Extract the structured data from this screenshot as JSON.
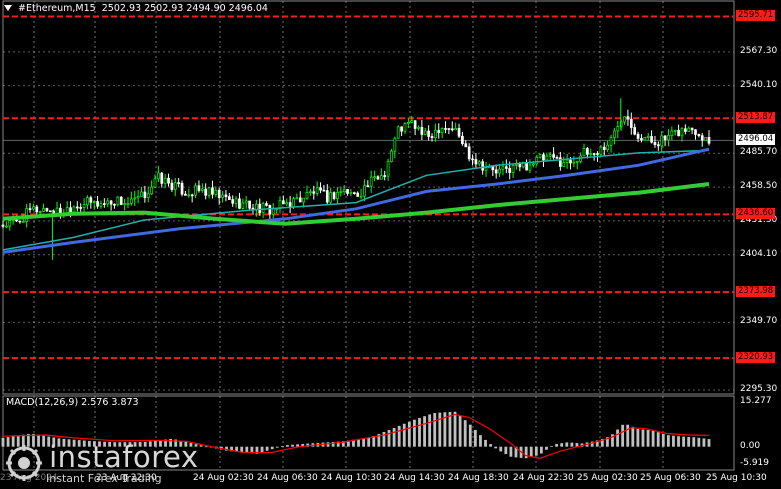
{
  "header": {
    "symbol": "#Ethereum,M15",
    "ohlc": "2502.93 2502.93 2494.90 2496.04"
  },
  "macd": {
    "label": "MACD(12,26,9) 2.576 3.873",
    "axis_labels": [
      "15.277",
      "0.00",
      "-5.919"
    ]
  },
  "price_axis": {
    "labels": [
      "2567.30",
      "2540.10",
      "2485.70",
      "2458.50",
      "2431.30",
      "2404.10",
      "2349.70",
      "2295.30"
    ]
  },
  "levels": [
    {
      "label": "2595.71",
      "value": 2595.71
    },
    {
      "label": "2513.87",
      "value": 2513.87
    },
    {
      "label": "2436.60",
      "value": 2436.6
    },
    {
      "label": "2373.98",
      "value": 2373.98
    },
    {
      "label": "2320.93",
      "value": 2320.93
    }
  ],
  "current_price": {
    "label": "2496.04",
    "value": 2496.04
  },
  "time_axis": {
    "labels": [
      "23 Aug 2024",
      "23 Aug 22:30",
      "24 Aug 02:30",
      "24 Aug 06:30",
      "24 Aug 10:30",
      "24 Aug 14:30",
      "24 Aug 18:30",
      "24 Aug 22:30",
      "25 Aug 02:30",
      "25 Aug 06:30",
      "25 Aug 10:30"
    ]
  },
  "watermark": {
    "brand": "instaforex",
    "tagline": "Instant Forex Trading"
  },
  "colors": {
    "background": "#000000",
    "bull": "#00ff00",
    "bear": "#ffffff",
    "level": "#ff1a1a",
    "ma_fast": "#20b2aa",
    "ma_mid": "#4169e1",
    "ma_slow": "#32cd32",
    "macd_hist": "#c0c0c0",
    "macd_signal": "#ff0000"
  },
  "chart_data": {
    "type": "candlestick",
    "price_range": [
      2295.3,
      2594.5
    ],
    "macd_range": [
      -5.919,
      15.277
    ],
    "close_path": [
      [
        0,
        2428
      ],
      [
        0.02,
        2430
      ],
      [
        0.04,
        2440
      ],
      [
        0.06,
        2441
      ],
      [
        0.08,
        2438
      ],
      [
        0.1,
        2444
      ],
      [
        0.12,
        2446
      ],
      [
        0.14,
        2445
      ],
      [
        0.16,
        2448
      ],
      [
        0.18,
        2445
      ],
      [
        0.2,
        2452
      ],
      [
        0.22,
        2466
      ],
      [
        0.24,
        2460
      ],
      [
        0.26,
        2454
      ],
      [
        0.28,
        2456
      ],
      [
        0.3,
        2452
      ],
      [
        0.32,
        2448
      ],
      [
        0.34,
        2445
      ],
      [
        0.36,
        2442
      ],
      [
        0.38,
        2440
      ],
      [
        0.4,
        2445
      ],
      [
        0.42,
        2449
      ],
      [
        0.44,
        2455
      ],
      [
        0.46,
        2450
      ],
      [
        0.48,
        2456
      ],
      [
        0.5,
        2452
      ],
      [
        0.52,
        2462
      ],
      [
        0.54,
        2470
      ],
      [
        0.56,
        2505
      ],
      [
        0.58,
        2510
      ],
      [
        0.6,
        2498
      ],
      [
        0.62,
        2508
      ],
      [
        0.64,
        2505
      ],
      [
        0.66,
        2485
      ],
      [
        0.68,
        2476
      ],
      [
        0.7,
        2470
      ],
      [
        0.72,
        2474
      ],
      [
        0.74,
        2476
      ],
      [
        0.76,
        2481
      ],
      [
        0.78,
        2481
      ],
      [
        0.8,
        2478
      ],
      [
        0.82,
        2485
      ],
      [
        0.84,
        2486
      ],
      [
        0.86,
        2495
      ],
      [
        0.88,
        2520
      ],
      [
        0.9,
        2500
      ],
      [
        0.92,
        2495
      ],
      [
        0.94,
        2497
      ],
      [
        0.96,
        2504
      ],
      [
        0.98,
        2505
      ],
      [
        1.0,
        2496
      ]
    ],
    "ma_fast": [
      [
        0,
        2408
      ],
      [
        0.1,
        2418
      ],
      [
        0.2,
        2432
      ],
      [
        0.35,
        2440
      ],
      [
        0.5,
        2446
      ],
      [
        0.6,
        2468
      ],
      [
        0.7,
        2476
      ],
      [
        0.8,
        2481
      ],
      [
        0.9,
        2486
      ],
      [
        1.0,
        2488
      ]
    ],
    "ma_mid": [
      [
        0,
        2406
      ],
      [
        0.1,
        2414
      ],
      [
        0.25,
        2425
      ],
      [
        0.4,
        2433
      ],
      [
        0.5,
        2441
      ],
      [
        0.6,
        2455
      ],
      [
        0.7,
        2461
      ],
      [
        0.8,
        2468
      ],
      [
        0.9,
        2476
      ],
      [
        1.0,
        2489
      ]
    ],
    "ma_slow": [
      [
        0,
        2433
      ],
      [
        0.1,
        2437
      ],
      [
        0.2,
        2438
      ],
      [
        0.3,
        2433
      ],
      [
        0.4,
        2429
      ],
      [
        0.5,
        2433
      ],
      [
        0.6,
        2438
      ],
      [
        0.7,
        2444
      ],
      [
        0.8,
        2449
      ],
      [
        0.9,
        2454
      ],
      [
        1.0,
        2461
      ]
    ],
    "macd_hist_path": [
      [
        0,
        3
      ],
      [
        0.04,
        4.5
      ],
      [
        0.08,
        2.8
      ],
      [
        0.12,
        2
      ],
      [
        0.16,
        1.5
      ],
      [
        0.2,
        1.6
      ],
      [
        0.24,
        2.7
      ],
      [
        0.28,
        0.5
      ],
      [
        0.32,
        -1.5
      ],
      [
        0.36,
        -2.4
      ],
      [
        0.4,
        0.5
      ],
      [
        0.44,
        1.2
      ],
      [
        0.48,
        1.8
      ],
      [
        0.52,
        3.2
      ],
      [
        0.55,
        6
      ],
      [
        0.58,
        9
      ],
      [
        0.61,
        11.5
      ],
      [
        0.64,
        12
      ],
      [
        0.66,
        8
      ],
      [
        0.68,
        3
      ],
      [
        0.7,
        -1
      ],
      [
        0.72,
        -3.5
      ],
      [
        0.74,
        -4
      ],
      [
        0.76,
        -2.8
      ],
      [
        0.78,
        0.8
      ],
      [
        0.8,
        1.5
      ],
      [
        0.82,
        1.1
      ],
      [
        0.84,
        2
      ],
      [
        0.86,
        3.5
      ],
      [
        0.88,
        8
      ],
      [
        0.9,
        6
      ],
      [
        0.92,
        5.6
      ],
      [
        0.94,
        4
      ],
      [
        0.96,
        3.5
      ],
      [
        0.98,
        3.2
      ],
      [
        1.0,
        2.6
      ]
    ],
    "macd_signal_path": [
      [
        0,
        3.6
      ],
      [
        0.06,
        4
      ],
      [
        0.1,
        3
      ],
      [
        0.16,
        2
      ],
      [
        0.22,
        2.2
      ],
      [
        0.26,
        1.8
      ],
      [
        0.3,
        -0.2
      ],
      [
        0.34,
        -2
      ],
      [
        0.38,
        -2
      ],
      [
        0.42,
        0
      ],
      [
        0.48,
        1.5
      ],
      [
        0.54,
        4
      ],
      [
        0.6,
        8
      ],
      [
        0.64,
        11
      ],
      [
        0.66,
        10
      ],
      [
        0.69,
        6
      ],
      [
        0.72,
        1
      ],
      [
        0.74,
        -3
      ],
      [
        0.76,
        -4
      ],
      [
        0.79,
        -1.5
      ],
      [
        0.83,
        1
      ],
      [
        0.86,
        3
      ],
      [
        0.89,
        6.5
      ],
      [
        0.91,
        6.2
      ],
      [
        0.94,
        4.5
      ],
      [
        0.97,
        4
      ],
      [
        1.0,
        3.9
      ]
    ]
  }
}
